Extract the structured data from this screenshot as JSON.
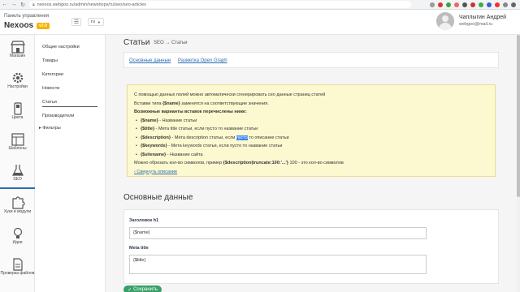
{
  "browser": {
    "url": "nexoos.webgoo.ru/admin/newshops/ru/seo/seo-articles",
    "back_icon": "arrow-left-icon",
    "forward_icon": "arrow-right-icon",
    "reload_icon": "reload-icon"
  },
  "header": {
    "panel_label": "Панель управления",
    "brand": "Nexoos",
    "version": "v7.0",
    "language": "ru",
    "user_name": "Чаплыгин Андрей",
    "user_email": "webgoo@mail.ru"
  },
  "icon_sidebar": [
    {
      "label": "Магазин",
      "icon": "store-icon"
    },
    {
      "label": "Настройки",
      "icon": "gear-icon"
    },
    {
      "label": "Цвета",
      "icon": "palette-icon"
    },
    {
      "label": "Шаблоны",
      "icon": "template-icon"
    },
    {
      "label": "SEO",
      "icon": "flask-icon",
      "active": true
    },
    {
      "label": "Хуки и модули",
      "icon": "puzzle-icon"
    },
    {
      "label": "Идеи",
      "icon": "lightbulb-icon"
    },
    {
      "label": "Проверка файлов",
      "icon": "file-check-icon"
    }
  ],
  "sub_nav": {
    "items": [
      "Общие настройки",
      "Товары",
      "Категории",
      "Новости",
      "Статьи",
      "Производители"
    ],
    "active_index": 4,
    "filter_label": "Фильтры"
  },
  "page": {
    "title": "Статьи",
    "breadcrumb": "SEO → Статьи",
    "tabs": [
      "Основные данные",
      "Разметка Open Graph"
    ]
  },
  "info": {
    "line1": "С помощью данных полей можно автоматически сгенерировать сео данные страниц статей",
    "line2_pre": "Вставки типа ",
    "line2_code": "{$name}",
    "line2_post": " заменятся на соответствующие значения.",
    "line3": "Возможные варианты вставок перечислены ниже:",
    "items": [
      {
        "code": "{$name}",
        "text": " - Название статьи"
      },
      {
        "code": "{$title}",
        "text": " - Мета title статьи, если пусто то название статьи"
      },
      {
        "code": "{$description}",
        "text_pre": " - Мета description статьи, если ",
        "text_hl": "пусто",
        "text_post": " то описание статьи"
      },
      {
        "code": "{$keywords}",
        "text": " - Мета keywords статьи, если пусто то название статьи"
      },
      {
        "code": "{$sitename}",
        "text": " - Название сайта"
      }
    ],
    "limit_pre": "Можно обрезать кол-во символов, пример ",
    "limit_code": "{$description|truncate:100:'...'}",
    "limit_post": " 100 - это кол-во символов",
    "collapse": "‹ Свернуть описание"
  },
  "form": {
    "section_title": "Основные данные",
    "h1_label": "Заголовок h1",
    "h1_value": "{$name}",
    "meta_title_label": "Meta title",
    "meta_title_value": "{$title}",
    "save_label": "Сохранить"
  }
}
